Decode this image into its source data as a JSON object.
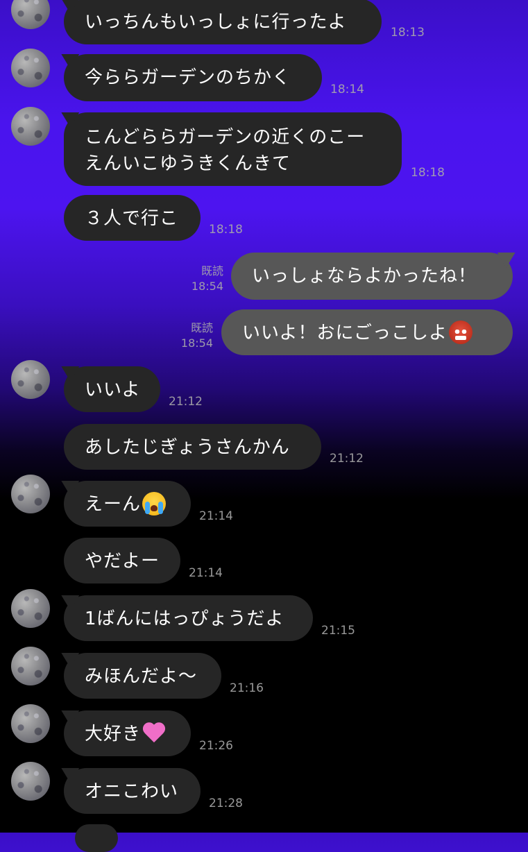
{
  "messages": [
    {
      "dir": "in",
      "text": "いっちんもいっしょに行ったよ",
      "time": "18:13"
    },
    {
      "dir": "in",
      "text": "今ららガーデンのちかく",
      "time": "18:14"
    },
    {
      "dir": "in",
      "line1": "こんどららガーデンの近くのこー",
      "line2": "えんいこゆうきくんきて",
      "time": "18:18"
    },
    {
      "dir": "in",
      "text": "３人で行こ",
      "time": "18:18"
    },
    {
      "dir": "out",
      "text": "いっしょならよかったね！",
      "read": "既読",
      "time": "18:54"
    },
    {
      "dir": "out",
      "text": "いいよ！おにごっこしよ",
      "emoji": "ogre-face",
      "read": "既読",
      "time": "18:54"
    },
    {
      "dir": "in",
      "text": "いいよ",
      "time": "21:12"
    },
    {
      "dir": "in",
      "text": "あしたじぎょうさんかん",
      "time": "21:12"
    },
    {
      "dir": "in",
      "text": "えーん",
      "emoji": "loudly-crying-face",
      "time": "21:14"
    },
    {
      "dir": "in",
      "text": "やだよー",
      "time": "21:14"
    },
    {
      "dir": "in",
      "text": "1ばんにはっぴょうだよ",
      "time": "21:15"
    },
    {
      "dir": "in",
      "text": "みほんだよ～",
      "time": "21:16"
    },
    {
      "dir": "in",
      "text": "大好き",
      "emoji": "pink-heart",
      "time": "21:26"
    },
    {
      "dir": "in",
      "text": "オニこわい",
      "time": "21:28"
    }
  ],
  "colors": {
    "incoming_bubble": "#262626",
    "outgoing_bubble": "#575757",
    "background_top": "#4a14ee",
    "background_bottom": "#000000"
  }
}
